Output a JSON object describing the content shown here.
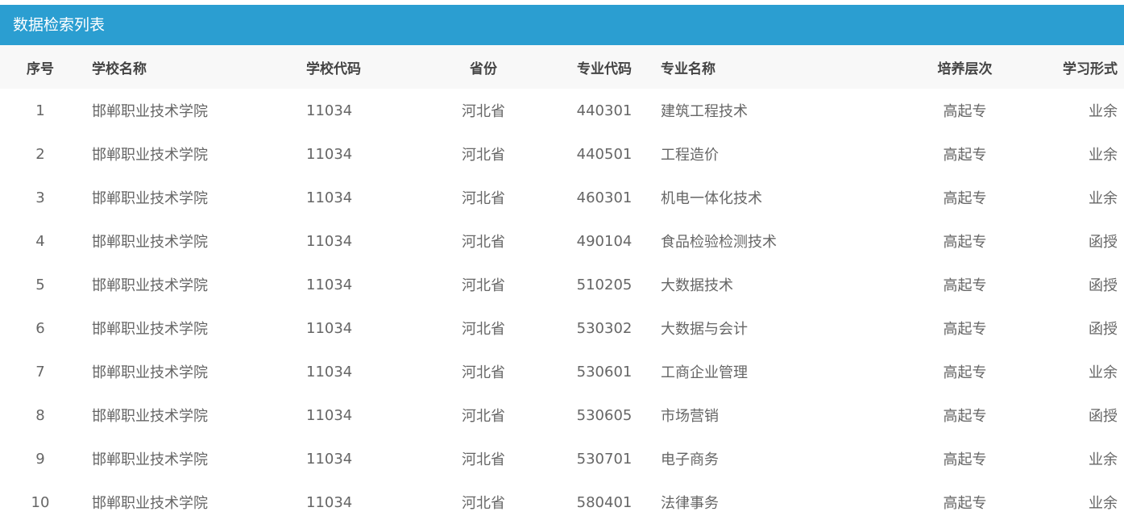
{
  "panel": {
    "title": "数据检索列表"
  },
  "table": {
    "headers": {
      "index": "序号",
      "school_name": "学校名称",
      "school_code": "学校代码",
      "province": "省份",
      "major_code": "专业代码",
      "major_name": "专业名称",
      "level": "培养层次",
      "mode": "学习形式"
    },
    "rows": [
      {
        "index": "1",
        "school_name": "邯郸职业技术学院",
        "school_code": "11034",
        "province": "河北省",
        "major_code": "440301",
        "major_name": "建筑工程技术",
        "level": "高起专",
        "mode": "业余"
      },
      {
        "index": "2",
        "school_name": "邯郸职业技术学院",
        "school_code": "11034",
        "province": "河北省",
        "major_code": "440501",
        "major_name": "工程造价",
        "level": "高起专",
        "mode": "业余"
      },
      {
        "index": "3",
        "school_name": "邯郸职业技术学院",
        "school_code": "11034",
        "province": "河北省",
        "major_code": "460301",
        "major_name": "机电一体化技术",
        "level": "高起专",
        "mode": "业余"
      },
      {
        "index": "4",
        "school_name": "邯郸职业技术学院",
        "school_code": "11034",
        "province": "河北省",
        "major_code": "490104",
        "major_name": "食品检验检测技术",
        "level": "高起专",
        "mode": "函授"
      },
      {
        "index": "5",
        "school_name": "邯郸职业技术学院",
        "school_code": "11034",
        "province": "河北省",
        "major_code": "510205",
        "major_name": "大数据技术",
        "level": "高起专",
        "mode": "函授"
      },
      {
        "index": "6",
        "school_name": "邯郸职业技术学院",
        "school_code": "11034",
        "province": "河北省",
        "major_code": "530302",
        "major_name": "大数据与会计",
        "level": "高起专",
        "mode": "函授"
      },
      {
        "index": "7",
        "school_name": "邯郸职业技术学院",
        "school_code": "11034",
        "province": "河北省",
        "major_code": "530601",
        "major_name": "工商企业管理",
        "level": "高起专",
        "mode": "业余"
      },
      {
        "index": "8",
        "school_name": "邯郸职业技术学院",
        "school_code": "11034",
        "province": "河北省",
        "major_code": "530605",
        "major_name": "市场营销",
        "level": "高起专",
        "mode": "函授"
      },
      {
        "index": "9",
        "school_name": "邯郸职业技术学院",
        "school_code": "11034",
        "province": "河北省",
        "major_code": "530701",
        "major_name": "电子商务",
        "level": "高起专",
        "mode": "业余"
      },
      {
        "index": "10",
        "school_name": "邯郸职业技术学院",
        "school_code": "11034",
        "province": "河北省",
        "major_code": "580401",
        "major_name": "法律事务",
        "level": "高起专",
        "mode": "业余"
      }
    ]
  },
  "colors": {
    "header_bar": "#2b9ed1",
    "table_head_bg": "#f8f8f8",
    "cell_text": "#666666",
    "head_text": "#444444"
  }
}
